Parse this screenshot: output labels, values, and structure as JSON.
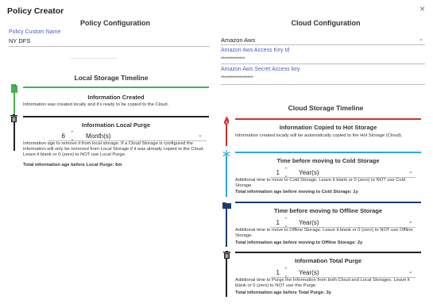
{
  "dialog": {
    "title": "Policy Creator",
    "close": "×"
  },
  "left": {
    "heading": "Policy Configuration",
    "name_label": "Policy Custom Name",
    "name_value": "NY DFS",
    "local_timeline_title": "Local Storage Timeline",
    "created": {
      "title": "Information Created",
      "text": "Information was created locally and it's ready to be copied to the Cloud."
    },
    "local_purge": {
      "title": "Information Local Purge",
      "value": "6",
      "unit": "Month(s)",
      "text": "Information age to remove it from local storage. If a Cloud Storage is configured the information will only be removed from Local Storage if it was already copied to the Cloud. Leave it blank or 0 (zero) to NOT use Local Purge.",
      "total": "Total information age before Local Purge: 6m"
    }
  },
  "right": {
    "heading": "Cloud Configuration",
    "provider_value": "Amazon Aws",
    "key_id_label": "Amazon Aws Access Key Id",
    "key_id_value": "************",
    "secret_label": "Amazon Aws Secret Access key",
    "secret_value": "****************",
    "cloud_timeline_title": "Cloud Storage Timeline",
    "hot": {
      "title": "Information Copied to Hot Storage",
      "text": "Information created locally will be automatically copied to the Hot Storage (Cloud)."
    },
    "cold": {
      "title": "Time before moving to Cold Storage",
      "value": "1",
      "unit": "Year(s)",
      "text": "Additional time to move to Cold Storage. Leave it blank or 0 (zero) to NOT use Cold Storage.",
      "total": "Total information age before moving to Cold Storage: 1y"
    },
    "offline": {
      "title": "Time before moving to Offline Storage",
      "value": "1",
      "unit": "Year(s)",
      "text": "Additional time to move to Offline Storage. Leave it blank or 0 (zero) to NOT use Offline Storage.",
      "total": "Total information age before moving to Offline Storage: 2y"
    },
    "purge": {
      "title": "Information Total Purge",
      "value": "1",
      "unit": "Year(s)",
      "text": "Additional time to Purge the Information from both Cloud and Local Storages. Leave it blank or 0 (zero) to NOT use this Purge.",
      "total": "Total information age before Total Purge: 3y"
    }
  },
  "colors": {
    "label_blue": "#4a5cc4",
    "created_green": "#4caf50",
    "hot_red": "#d32f2f",
    "cold_blue": "#29a8e0",
    "offline_navy": "#1f3a6e",
    "purge_black": "#212121"
  },
  "icons": {
    "created": "file-icon",
    "local_purge": "trash-icon",
    "hot": "fire-icon",
    "cold": "snowflake-icon",
    "offline": "folder-icon",
    "purge": "trash-icon"
  }
}
